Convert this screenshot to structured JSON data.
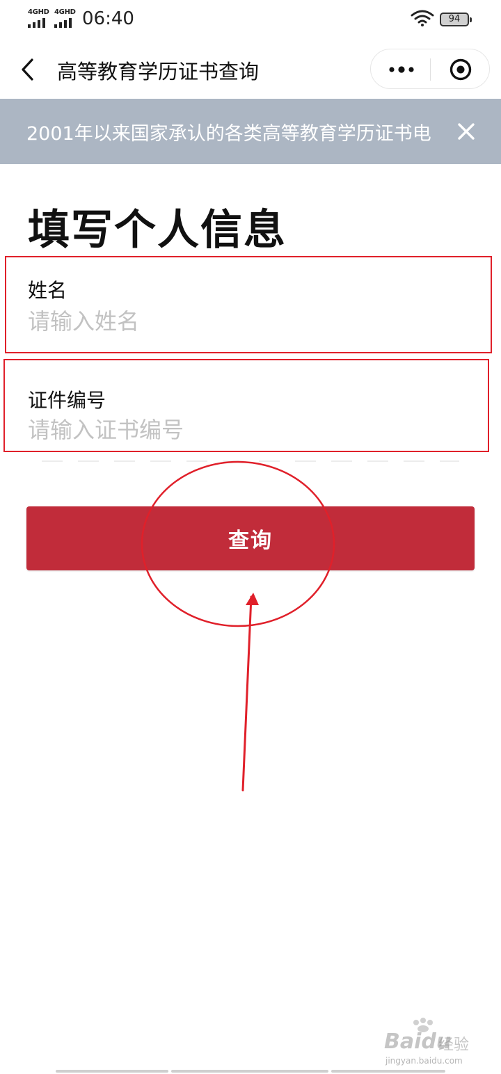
{
  "status_bar": {
    "network_1": "4GHD",
    "network_2": "4GHD",
    "time": "06:40",
    "battery": "94"
  },
  "nav": {
    "title": "高等教育学历证书查询"
  },
  "notice": {
    "text": "2001年以来国家承认的各类高等教育学历证书电"
  },
  "page": {
    "title": "填写个人信息"
  },
  "form": {
    "name_label": "姓名",
    "name_placeholder": "请输入姓名",
    "cert_label": "证件编号",
    "cert_placeholder": "请输入证书编号",
    "submit_label": "查询"
  },
  "watermark": {
    "brand": "Baidu",
    "label": "经验",
    "url": "jingyan.baidu.com"
  },
  "colors": {
    "accent": "#c12c3a",
    "notice_bg": "#acb6c3",
    "annotation_red": "#e0202a"
  },
  "icons": [
    "back-icon",
    "more-icon",
    "target-icon",
    "close-icon",
    "wifi-icon",
    "battery-icon",
    "signal-icon"
  ]
}
